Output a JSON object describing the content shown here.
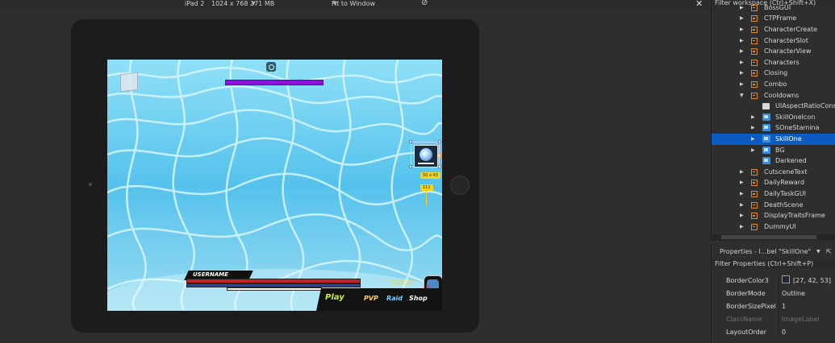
{
  "device_bar": {
    "device": "iPad 2",
    "resolution": "1024 x 768",
    "memory": "271 MB",
    "fit": "Fit to Window"
  },
  "game": {
    "username": "USERNAME",
    "menu": {
      "play": "Play",
      "pvp": "PVP",
      "raid": "Raid",
      "shop": "Shop"
    },
    "notice_line1": "You Have Received",
    "notice_line2": "New Rewards",
    "selection_size": "50 x 43",
    "selection_tag2": "111",
    "colors": {
      "water": "#6fd0ef",
      "boss_bar": "#8f12d9",
      "hp": "#c32226",
      "mp": "#2446a8",
      "play": "#c6f23a",
      "pvp": "#ffd54a",
      "raid": "#6ad3ff",
      "shop": "#ffffff"
    }
  },
  "explorer": {
    "filter_placeholder": "Filter workspace (Ctrl+Shift+X)",
    "items": [
      {
        "label": "BossGUI",
        "type": "frame",
        "level": 0,
        "arrow": "right"
      },
      {
        "label": "CTPFrame",
        "type": "frame",
        "level": 0,
        "arrow": "right"
      },
      {
        "label": "CharacterCreate",
        "type": "frame",
        "level": 0,
        "arrow": "right"
      },
      {
        "label": "CharacterSlot",
        "type": "frame",
        "level": 0,
        "arrow": "right"
      },
      {
        "label": "CharacterView",
        "type": "frame",
        "level": 0,
        "arrow": "right"
      },
      {
        "label": "Characters",
        "type": "frame",
        "level": 0,
        "arrow": "right"
      },
      {
        "label": "Closing",
        "type": "frame",
        "level": 0,
        "arrow": "right"
      },
      {
        "label": "Combo",
        "type": "frame",
        "level": 0,
        "arrow": "right"
      },
      {
        "label": "Cooldowns",
        "type": "frame",
        "level": 0,
        "arrow": "down"
      },
      {
        "label": "UIAspectRatioCons",
        "type": "ratio",
        "level": 1,
        "arrow": ""
      },
      {
        "label": "SkillOneIcon",
        "type": "image",
        "level": 1,
        "arrow": "right"
      },
      {
        "label": "SOneStamina",
        "type": "image",
        "level": 1,
        "arrow": "right"
      },
      {
        "label": "SkillOne",
        "type": "image",
        "level": 1,
        "arrow": "right",
        "selected": true
      },
      {
        "label": "BG",
        "type": "image",
        "level": 1,
        "arrow": "right"
      },
      {
        "label": "Darkened",
        "type": "image",
        "level": 1,
        "arrow": ""
      },
      {
        "label": "CutsceneText",
        "type": "frame",
        "level": 0,
        "arrow": "right"
      },
      {
        "label": "DailyReward",
        "type": "frame",
        "level": 0,
        "arrow": "right"
      },
      {
        "label": "DailyTaskGUI",
        "type": "frame",
        "level": 0,
        "arrow": "right"
      },
      {
        "label": "DeathScene",
        "type": "frame",
        "level": 0,
        "arrow": "right"
      },
      {
        "label": "DisplayTraitsFrame",
        "type": "frame",
        "level": 0,
        "arrow": "right"
      },
      {
        "label": "DummyUI",
        "type": "frame",
        "level": 0,
        "arrow": "right"
      }
    ]
  },
  "properties": {
    "title": "Properties - I...bel \"SkillOne\"",
    "filter_placeholder": "Filter Properties (Ctrl+Shift+P)",
    "rows": [
      {
        "name": "BorderColor3",
        "value": "[27, 42, 53]",
        "swatch": "#1b2a35"
      },
      {
        "name": "BorderMode",
        "value": "Outline"
      },
      {
        "name": "BorderSizePixel",
        "value": "1"
      },
      {
        "name": "ClassName",
        "value": "ImageLabel",
        "dim": true
      },
      {
        "name": "LayoutOrder",
        "value": "0"
      }
    ]
  }
}
